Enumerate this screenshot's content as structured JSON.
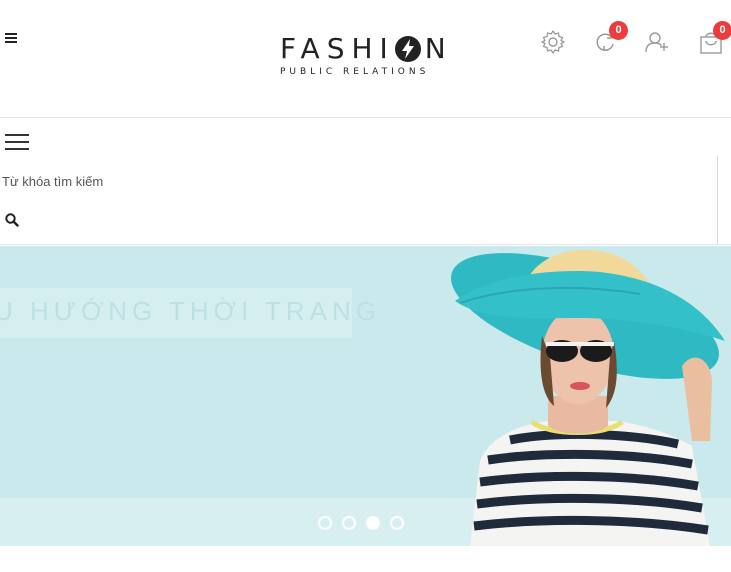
{
  "header": {
    "logo_main": "FASHI",
    "logo_main_end": "N",
    "logo_sub": "PUBLIC RELATIONS",
    "compare_count": "0",
    "cart_count": "0"
  },
  "icons": {
    "menu": "bars-icon",
    "settings": "gear-icon",
    "compare": "refresh-icon",
    "account": "user-plus-icon",
    "cart": "shopping-bag-icon",
    "search": "search-icon",
    "logo_mark": "lightning-bolt-icon"
  },
  "search": {
    "placeholder": "Từ khóa tìm kiếm"
  },
  "banner": {
    "headline": "U HƯỚNG THỜI TRANG",
    "slides_total": 4,
    "active_slide": 3
  },
  "colors": {
    "badge": "#ef3b3b",
    "banner_bg": "#c9e9ec",
    "hat_teal": "#2fb9c2"
  }
}
